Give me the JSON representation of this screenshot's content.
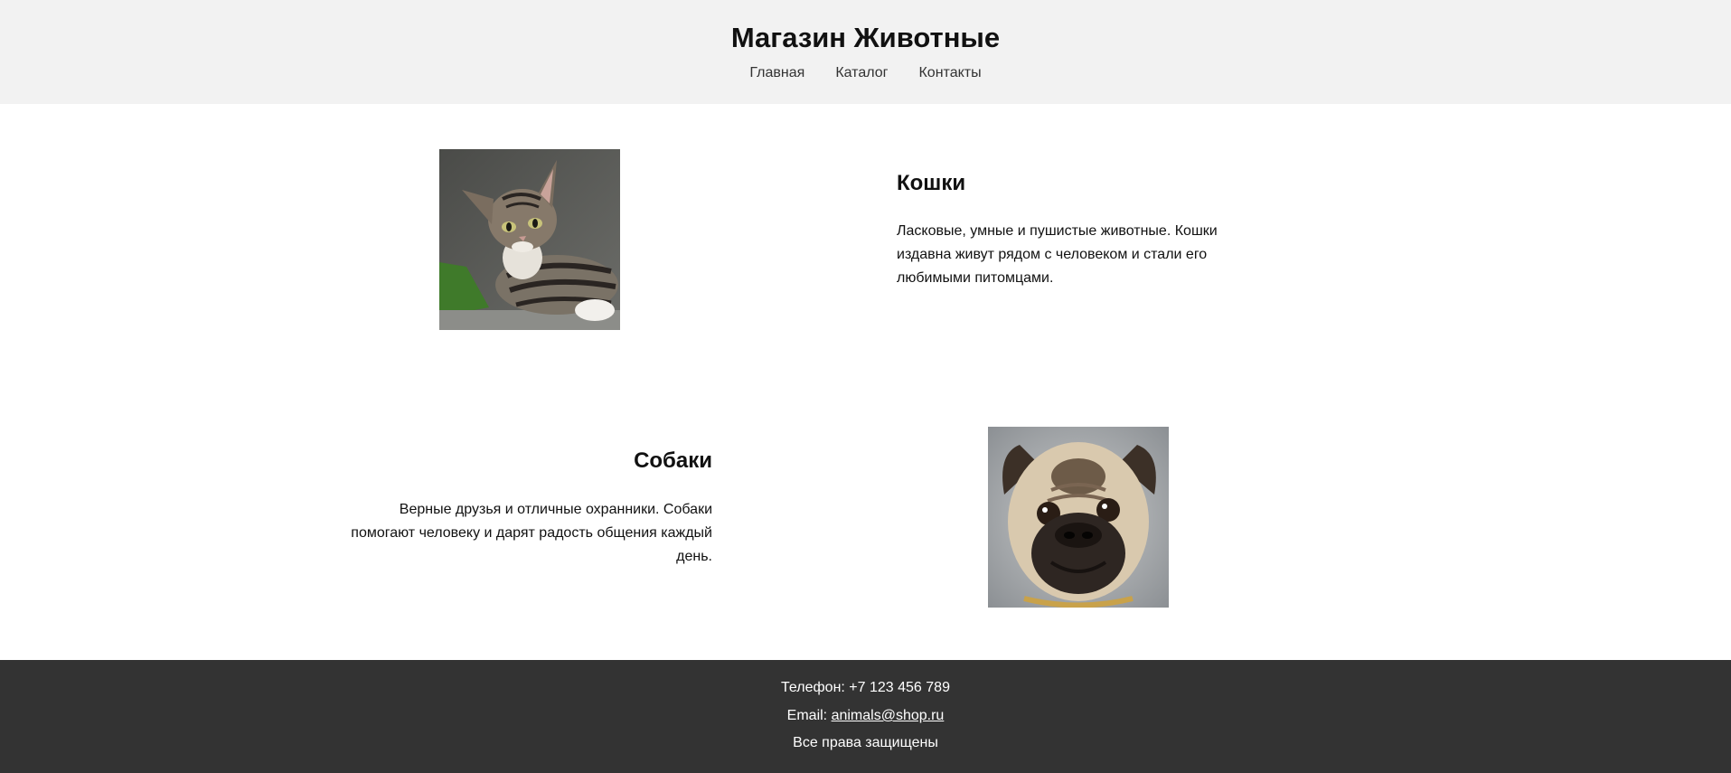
{
  "header": {
    "title": "Магазин Животные",
    "nav": [
      "Главная",
      "Каталог",
      "Контакты"
    ]
  },
  "sections": [
    {
      "title": "Кошки",
      "text": "Ласковые, умные и пушистые животные. Кошки издавна живут рядом с человеком и стали его любимыми питомцами.",
      "image": "cat-photo"
    },
    {
      "title": "Собаки",
      "text": "Верные друзья и отличные охранники. Собаки помогают человеку и дарят радость общения каждый день.",
      "image": "pug-photo"
    }
  ],
  "footer": {
    "phone_label": "Телефон: ",
    "phone": "+7 123 456 789",
    "email_label": "Email: ",
    "email": "animals@shop.ru",
    "rights": "Все права защищены"
  },
  "colors": {
    "header_bg": "#f2f2f2",
    "footer_bg": "#333333",
    "text": "#111111"
  }
}
